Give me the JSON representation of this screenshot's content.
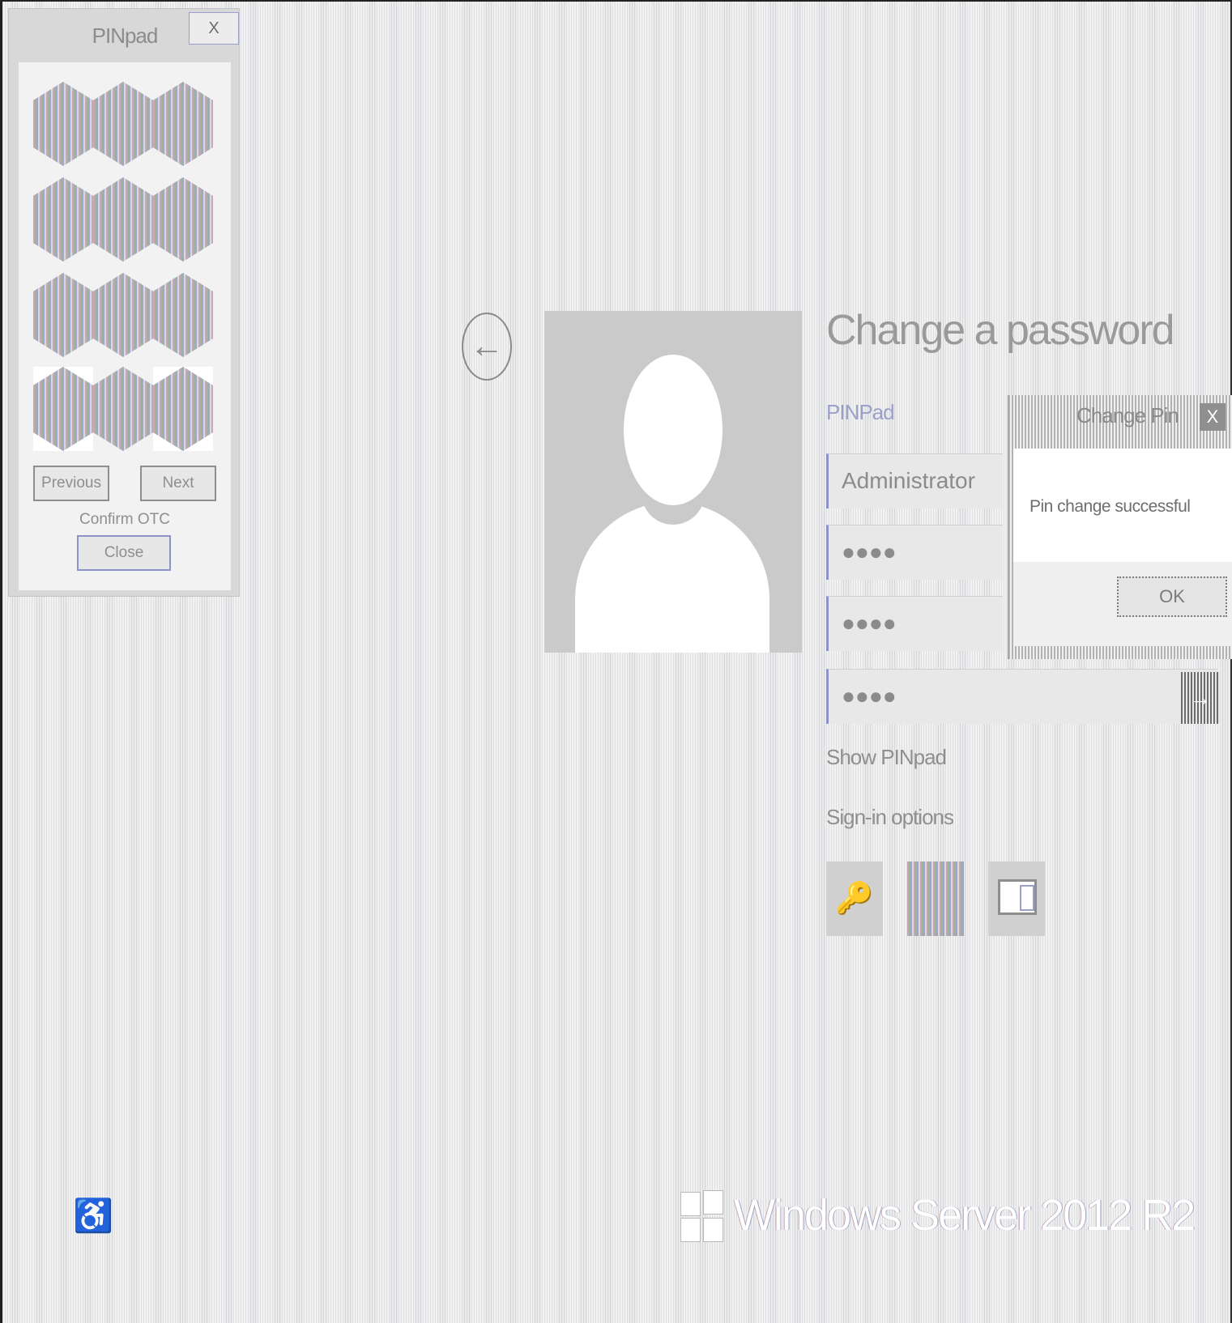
{
  "pinpad": {
    "title": "PINpad",
    "close_label": "X",
    "previous_label": "Previous",
    "next_label": "Next",
    "confirm_label": "Confirm OTC",
    "close_button_label": "Close",
    "key_count": 12
  },
  "back_button": {
    "glyph": "←",
    "icon": "back-arrow-icon"
  },
  "avatar": {
    "icon": "user-avatar-icon"
  },
  "form": {
    "title": "Change a password",
    "provider_label": "PINPad",
    "username": "Administrator",
    "fields": [
      "●●●●",
      "●●●●",
      "●●●●"
    ],
    "submit_glyph": "→",
    "show_pinpad_link": "Show PINpad",
    "sign_in_options_link": "Sign-in options"
  },
  "sign_in_tiles": [
    {
      "icon": "key-icon",
      "glyph": "🔑"
    },
    {
      "icon": "pinpad-tile-icon"
    },
    {
      "icon": "smart-card-icon"
    }
  ],
  "dialog": {
    "title": "Change Pin",
    "close_label": "X",
    "message": "Pin change successful",
    "ok_label": "OK"
  },
  "footer": {
    "ease_of_access_glyph": "♿",
    "brand": "Windows Server 2012 R2"
  }
}
